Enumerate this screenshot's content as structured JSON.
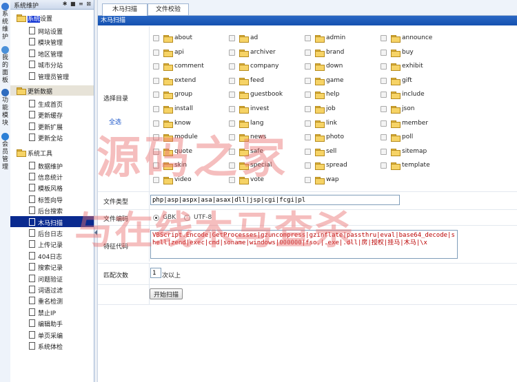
{
  "vtabs": [
    {
      "label": "系统维护",
      "icon": "cog-icon"
    },
    {
      "label": "我的面板",
      "icon": "home-icon"
    },
    {
      "label": "功能模块",
      "icon": "gears-icon"
    },
    {
      "label": "会员管理",
      "icon": "user-icon"
    }
  ],
  "sidebar": {
    "title": "系统维护",
    "header_buttons": "✱ ■ ≡ ⊠",
    "groups": [
      {
        "label_pre": "",
        "label_hl": "系统",
        "label_post": "设置",
        "items": [
          "网站设置",
          "模块管理",
          "地区管理",
          "城市分站",
          "管理员管理"
        ]
      },
      {
        "label_pre": "更新数据",
        "label_hl": "",
        "label_post": "",
        "items": [
          "生成首页",
          "更新缓存",
          "更新扩展",
          "更新全站"
        ]
      },
      {
        "label_pre": "系统工具",
        "label_hl": "",
        "label_post": "",
        "items": [
          "数据维护",
          "信息统计",
          "模板风格",
          "标签向导",
          "后台搜索",
          "木马扫描",
          "后台日志",
          "上传记录",
          "404日志",
          "搜索记录",
          "问题验证",
          "词语过滤",
          "重名检测",
          "禁止IP",
          "编辑助手",
          "单页采编",
          "系统体检"
        ]
      }
    ],
    "selected_item": "木马扫描"
  },
  "tabs": [
    "木马扫描",
    "文件校验"
  ],
  "panel_title": "木马扫描",
  "form": {
    "dir_label": "选择目录",
    "select_all": "全选",
    "dirs": [
      "about",
      "ad",
      "admin",
      "announce",
      "api",
      "archiver",
      "brand",
      "buy",
      "comment",
      "company",
      "down",
      "exhibit",
      "extend",
      "feed",
      "game",
      "gift",
      "group",
      "guestbook",
      "help",
      "include",
      "install",
      "invest",
      "job",
      "json",
      "know",
      "lang",
      "link",
      "member",
      "module",
      "news",
      "photo",
      "poll",
      "quote",
      "safe",
      "sell",
      "sitemap",
      "skin",
      "special",
      "spread",
      "template",
      "video",
      "vote",
      "wap"
    ],
    "filetype_label": "文件类型",
    "filetype_value": "php|asp|aspx|asa|asax|dll|jsp|cgi|fcgi|pl",
    "encoding_label": "文件编码",
    "encoding_options": [
      "GBK",
      "UTF-8"
    ],
    "encoding_selected": "GBK",
    "feature_label": "特征代码",
    "feature_value": "VBScript.Encode|GetProcesses|gzuncompress|gzinflate|passthru|eval|base64_decode|shell|zend|exec|cmd|soname|windows|000000|fso.|.exe|.dll|房|授权|挂马|木马|\\x",
    "match_label": "匹配次数",
    "match_value": "1",
    "match_suffix": "次以上",
    "submit_label": "开始扫描"
  },
  "watermark": {
    "line1": "源码之家",
    "line2": "与在线木马查杀"
  },
  "colors": {
    "title_bar": "#1551b0",
    "selected_bg": "#0a2a8f",
    "watermark": "#e86e6e"
  }
}
